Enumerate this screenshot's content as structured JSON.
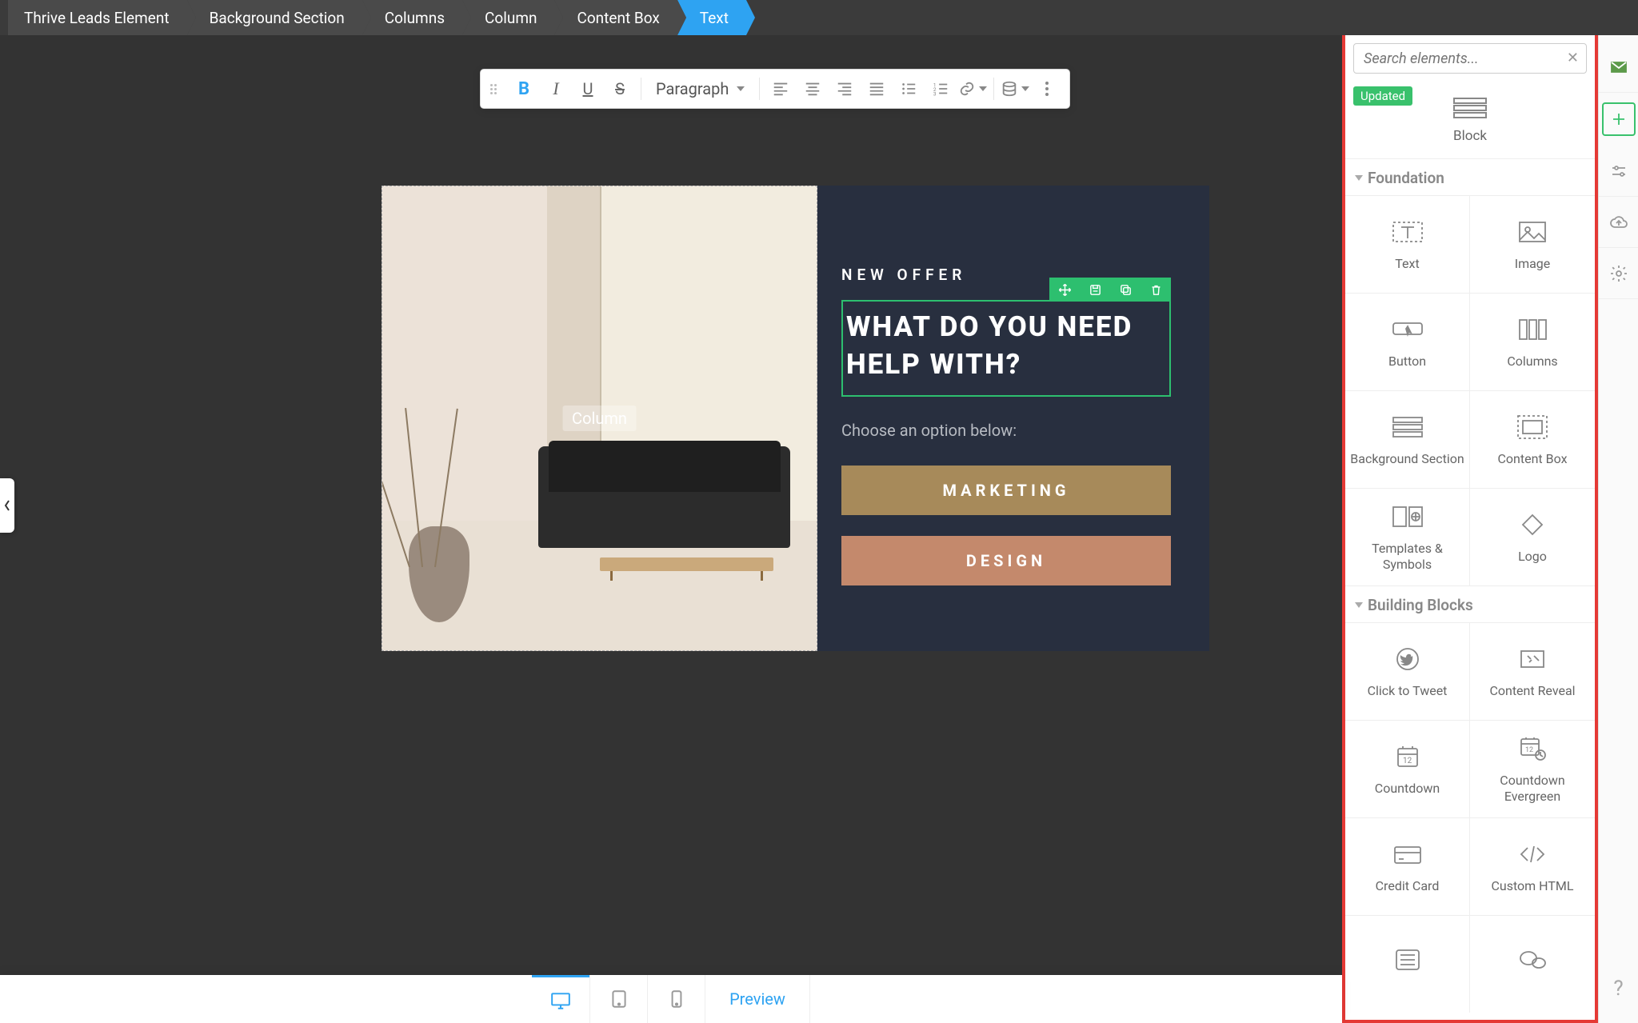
{
  "breadcrumb": [
    "Thrive Leads Element",
    "Background Section",
    "Columns",
    "Column",
    "Content Box",
    "Text"
  ],
  "toolbar": {
    "paragraph_label": "Paragraph"
  },
  "search": {
    "placeholder": "Search elements..."
  },
  "feature": {
    "badge": "Updated",
    "label": "Block"
  },
  "sections": {
    "foundation": {
      "title": "Foundation",
      "items": [
        "Text",
        "Image",
        "Button",
        "Columns",
        "Background Section",
        "Content Box",
        "Templates & Symbols",
        "Logo"
      ]
    },
    "building": {
      "title": "Building Blocks",
      "items": [
        "Click to Tweet",
        "Content Reveal",
        "Countdown",
        "Countdown Evergreen",
        "Credit Card",
        "Custom HTML"
      ]
    }
  },
  "canvas": {
    "placeholder": "Column",
    "offer_label": "NEW OFFER",
    "heading": "WHAT DO YOU NEED HELP WITH?",
    "subtitle": "Choose an option below:",
    "btn_marketing": "MARKETING",
    "btn_design": "DESIGN"
  },
  "bottom": {
    "preview": "Preview"
  }
}
